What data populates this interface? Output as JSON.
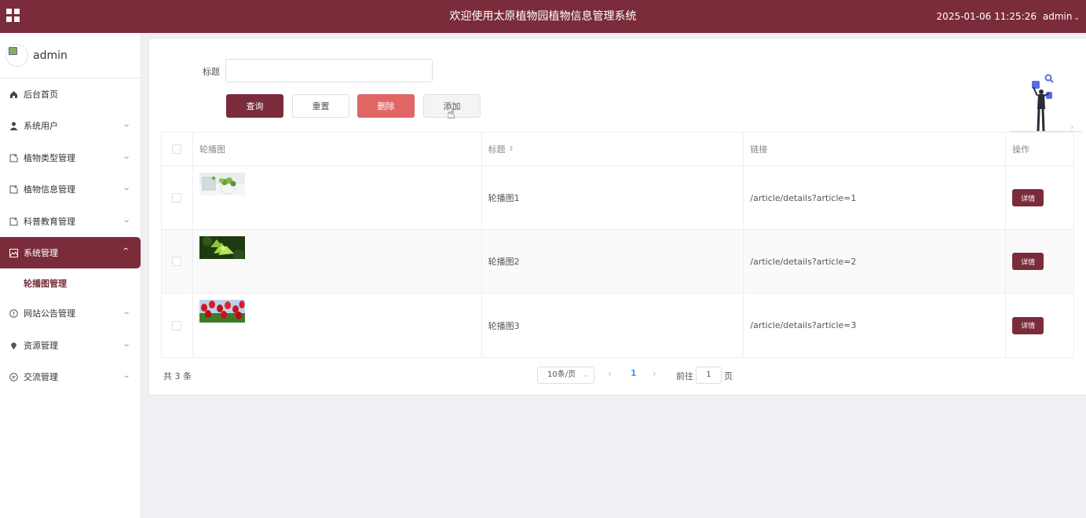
{
  "header": {
    "title": "欢迎使用太原植物园植物信息管理系统",
    "datetime": "2025-01-06 11:25:26",
    "user": "admin",
    "brand_color": "#7a2c3a"
  },
  "sidebar": {
    "username": "admin",
    "items": [
      {
        "label": "后台首页",
        "icon": "home-icon"
      },
      {
        "label": "系统用户",
        "icon": "user-icon"
      },
      {
        "label": "植物类型管理",
        "icon": "document-icon"
      },
      {
        "label": "植物信息管理",
        "icon": "document-icon"
      },
      {
        "label": "科普教育管理",
        "icon": "document-icon"
      },
      {
        "label": "系统管理",
        "icon": "picture-icon"
      },
      {
        "label": "网站公告管理",
        "icon": "info-icon"
      },
      {
        "label": "资源管理",
        "icon": "location-icon"
      },
      {
        "label": "交流管理",
        "icon": "chat-icon"
      }
    ],
    "subitem": "轮播图管理"
  },
  "search": {
    "label": "标题",
    "value": ""
  },
  "buttons": {
    "query": "查询",
    "reset": "重置",
    "delete": "删除",
    "add": "添加"
  },
  "table": {
    "columns": {
      "image": "轮播图",
      "title": "标题",
      "link": "链接",
      "op": "操作"
    },
    "rows": [
      {
        "title": "轮播图1",
        "link": "/article/details?article=1",
        "action": "详情"
      },
      {
        "title": "轮播图2",
        "link": "/article/details?article=2",
        "action": "详情"
      },
      {
        "title": "轮播图3",
        "link": "/article/details?article=3",
        "action": "详情"
      }
    ]
  },
  "pagination": {
    "total": "共 3 条",
    "page_size": "10条/页",
    "current": "1",
    "goto_label": "前往",
    "goto_value": "1",
    "goto_suffix": "页"
  }
}
